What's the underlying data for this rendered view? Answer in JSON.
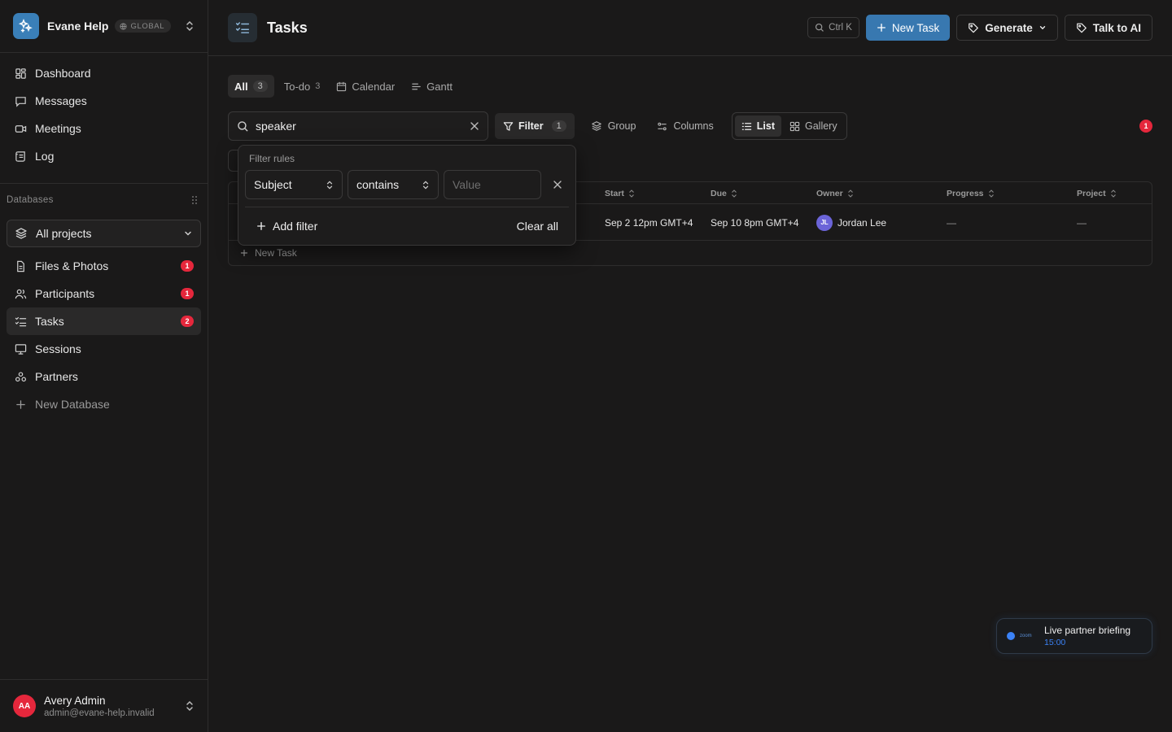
{
  "workspace": {
    "name": "Evane Help",
    "badge": "GLOBAL"
  },
  "nav": [
    {
      "label": "Dashboard",
      "icon": "dashboard-icon"
    },
    {
      "label": "Messages",
      "icon": "message-icon"
    },
    {
      "label": "Meetings",
      "icon": "video-icon"
    },
    {
      "label": "Log",
      "icon": "scroll-icon"
    }
  ],
  "databases": {
    "heading": "Databases",
    "selector": "All projects",
    "items": [
      {
        "label": "Files & Photos",
        "count": "1"
      },
      {
        "label": "Participants",
        "count": "1"
      },
      {
        "label": "Tasks",
        "count": "2",
        "active": true
      },
      {
        "label": "Sessions",
        "count": ""
      },
      {
        "label": "Partners",
        "count": ""
      }
    ],
    "new_label": "New Database"
  },
  "profile": {
    "initials": "AA",
    "name": "Avery Admin",
    "email": "admin@evane-help.invalid"
  },
  "topbar": {
    "title": "Tasks",
    "shortcut": "Ctrl K",
    "new_task": "New Task",
    "generate": "Generate",
    "talk_ai": "Talk to AI"
  },
  "views": [
    {
      "label": "All",
      "count": "3",
      "active": true
    },
    {
      "label": "To-do",
      "count": "3"
    },
    {
      "label": "Calendar",
      "count": ""
    },
    {
      "label": "Gantt",
      "count": ""
    }
  ],
  "toolbar": {
    "search_value": "speaker",
    "filter_label": "Filter",
    "filter_count": "1",
    "group": "Group",
    "columns": "Columns",
    "list": "List",
    "gallery": "Gallery",
    "notif_count": "1"
  },
  "table": {
    "headers": [
      "Start",
      "Due",
      "Owner",
      "Progress",
      "Project"
    ],
    "rows": [
      {
        "start": "Sep 2 12pm GMT+4",
        "due": "Sep 10 8pm GMT+4",
        "owner_initials": "JL",
        "owner": "Jordan Lee",
        "progress": "—",
        "project": "—"
      }
    ],
    "new_task": "New Task"
  },
  "filter_popover": {
    "title": "Filter rules",
    "field": "Subject",
    "operator": "contains",
    "value_placeholder": "Value",
    "add_filter": "Add filter",
    "clear_all": "Clear all"
  },
  "meeting_toast": {
    "app": "zoom",
    "title": "Live partner briefing",
    "time": "15:00"
  },
  "colors": {
    "accent": "#3878b0",
    "badge": "#e5273c",
    "background": "#1a1919"
  }
}
